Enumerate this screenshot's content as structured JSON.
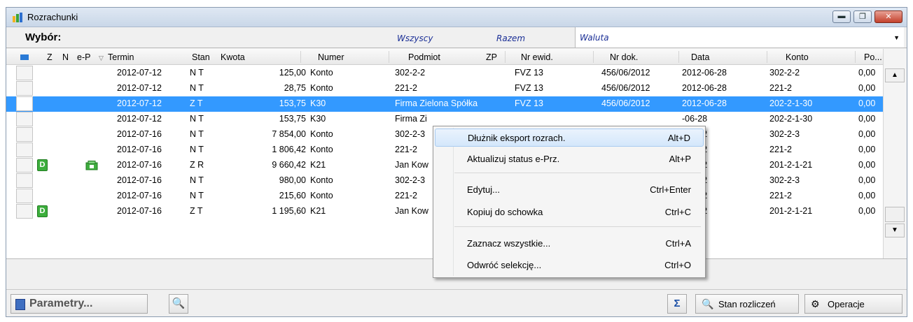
{
  "window": {
    "title": "Rozrachunki",
    "min": "▬",
    "max": "❐",
    "close": "✕"
  },
  "filters": {
    "wybor": "Wybór:",
    "wszyscy": "Wszyscy",
    "razem": "Razem",
    "waluta": "Waluta"
  },
  "columns": [
    "Z",
    "N",
    "e-P",
    "Termin",
    "Stan",
    "Kwota",
    "Numer",
    "Podmiot",
    "ZP",
    "Nr ewid.",
    "Nr dok.",
    "Data",
    "Konto",
    "Po..."
  ],
  "rows": [
    {
      "z": "",
      "ep": "",
      "termin": "2012-07-12",
      "stan": "N T",
      "kwota": "125,00",
      "numer": "Konto",
      "podmiot": "302-2-2",
      "nrewid": "FVZ  13",
      "nrdok": "456/06/2012",
      "data": "2012-06-28",
      "konto": "302-2-2",
      "po": "0,00"
    },
    {
      "z": "",
      "ep": "",
      "termin": "2012-07-12",
      "stan": "N T",
      "kwota": "28,75",
      "numer": "Konto",
      "podmiot": "221-2",
      "nrewid": "FVZ  13",
      "nrdok": "456/06/2012",
      "data": "2012-06-28",
      "konto": "221-2",
      "po": "0,00"
    },
    {
      "z": "",
      "ep": "",
      "termin": "2012-07-12",
      "stan": "Z T",
      "kwota": "153,75",
      "numer": "K30",
      "podmiot": "Firma Zielona Spółka",
      "nrewid": "FVZ  13",
      "nrdok": "456/06/2012",
      "data": "2012-06-28",
      "konto": "202-2-1-30",
      "po": "0,00"
    },
    {
      "z": "",
      "ep": "",
      "termin": "2012-07-12",
      "stan": "N T",
      "kwota": "153,75",
      "numer": "K30",
      "podmiot": "Firma Zi",
      "nrewid": "",
      "nrdok": "",
      "data": "-06-28",
      "konto": "202-2-1-30",
      "po": "0,00"
    },
    {
      "z": "",
      "ep": "",
      "termin": "2012-07-16",
      "stan": "N T",
      "kwota": "7 854,00",
      "numer": "Konto",
      "podmiot": "302-2-3",
      "nrewid": "",
      "nrdok": "",
      "data": "-07-02",
      "konto": "302-2-3",
      "po": "0,00"
    },
    {
      "z": "",
      "ep": "",
      "termin": "2012-07-16",
      "stan": "N T",
      "kwota": "1 806,42",
      "numer": "Konto",
      "podmiot": "221-2",
      "nrewid": "",
      "nrdok": "",
      "data": "-07-02",
      "konto": "221-2",
      "po": "0,00"
    },
    {
      "z": "D",
      "ep": "icon",
      "termin": "2012-07-16",
      "stan": "Z R",
      "kwota": "9 660,42",
      "numer": "K21",
      "podmiot": "Jan Kow",
      "nrewid": "",
      "nrdok": "",
      "data": "-07-02",
      "konto": "201-2-1-21",
      "po": "0,00"
    },
    {
      "z": "",
      "ep": "",
      "termin": "2012-07-16",
      "stan": "N T",
      "kwota": "980,00",
      "numer": "Konto",
      "podmiot": "302-2-3",
      "nrewid": "",
      "nrdok": "",
      "data": "-07-02",
      "konto": "302-2-3",
      "po": "0,00"
    },
    {
      "z": "",
      "ep": "",
      "termin": "2012-07-16",
      "stan": "N T",
      "kwota": "215,60",
      "numer": "Konto",
      "podmiot": "221-2",
      "nrewid": "",
      "nrdok": "",
      "data": "-07-02",
      "konto": "221-2",
      "po": "0,00"
    },
    {
      "z": "D",
      "ep": "",
      "termin": "2012-07-16",
      "stan": "Z T",
      "kwota": "1 195,60",
      "numer": "K21",
      "podmiot": "Jan Kow",
      "nrewid": "",
      "nrdok": "",
      "data": "-07-02",
      "konto": "201-2-1-21",
      "po": "0,00"
    }
  ],
  "context_menu": [
    {
      "label": "Dłużnik eksport rozrach.",
      "shortcut": "Alt+D"
    },
    {
      "label": "Aktualizuj status e-Prz.",
      "shortcut": "Alt+P"
    },
    {
      "label": "Edytuj...",
      "shortcut": "Ctrl+Enter"
    },
    {
      "label": "Kopiuj do schowka",
      "shortcut": "Ctrl+C"
    },
    {
      "label": "Zaznacz wszystkie...",
      "shortcut": "Ctrl+A"
    },
    {
      "label": "Odwróć selekcję...",
      "shortcut": "Ctrl+O"
    }
  ],
  "bottom": {
    "parametry": "Parametry...",
    "stan_rozliczen": "Stan rozliczeń",
    "operacje": "Operacje",
    "sigma": "Σ"
  },
  "colors": {
    "selection": "#3399ff",
    "filter_text": "#1b2f96"
  }
}
